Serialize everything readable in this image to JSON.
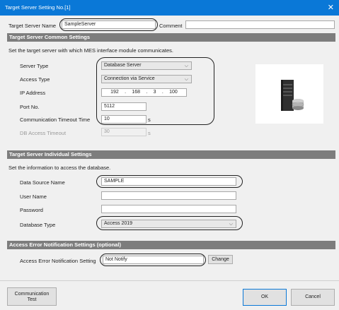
{
  "window": {
    "title": "Target Server Setting No.[1]",
    "close_glyph": "✕"
  },
  "header": {
    "server_name_label": "Target Server Name",
    "server_name_value": "SampleServer",
    "comment_label": "Comment",
    "comment_value": ""
  },
  "common": {
    "title": "Target Server Common Settings",
    "description": "Set the target server with which MES interface module communicates.",
    "server_type_label": "Server Type",
    "server_type_value": "Database Server",
    "access_type_label": "Access Type",
    "access_type_value": "Connection via Service",
    "ip_label": "IP Address",
    "ip_octets": [
      "192",
      "168",
      "3",
      "100"
    ],
    "ip_separator": ".",
    "port_label": "Port No.",
    "port_value": "5112",
    "comm_timeout_label": "Communication Timeout Time",
    "comm_timeout_value": "10",
    "comm_timeout_unit": "s",
    "db_timeout_label": "DB Access Timeout",
    "db_timeout_value": "30",
    "db_timeout_unit": "s"
  },
  "individual": {
    "title": "Target Server Individual Settings",
    "description": "Set the information to access the database.",
    "dsn_label": "Data Source Name",
    "dsn_value": "SAMPLE",
    "user_label": "User Name",
    "user_value": "",
    "password_label": "Password",
    "password_value": "",
    "db_type_label": "Database Type",
    "db_type_value": "Access 2019"
  },
  "error_notify": {
    "title": "Access Error Notification Settings (optional)",
    "setting_label": "Access Error Notification Setting",
    "setting_value": "Not Notify",
    "change_label": "Change"
  },
  "footer": {
    "comm_test_line1": "Communication",
    "comm_test_line2": "Test",
    "ok_label": "OK",
    "cancel_label": "Cancel"
  },
  "icons": {
    "chevron": "chevron-down-icon",
    "server": "database-server-icon"
  }
}
